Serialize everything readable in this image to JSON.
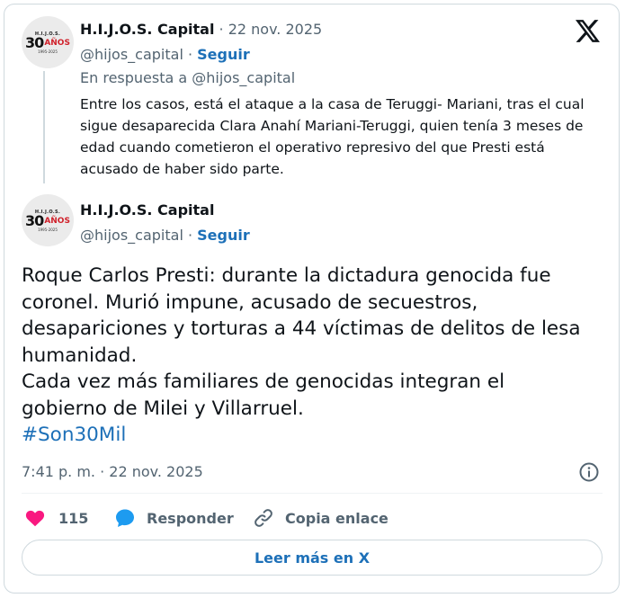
{
  "quoted_tweet": {
    "author_name": "H.I.J.O.S. Capital",
    "date": "22 nov. 2025",
    "handle": "@hijos_capital",
    "follow_label": "Seguir",
    "reply_to": "En respuesta a @hijos_capital",
    "text": "Entre los casos, está el ataque a la casa de Teruggi- Mariani, tras el cual sigue desaparecida Clara Anahí Mariani-Teruggi, quien tenía 3 meses de edad cuando cometieron el operativo represivo del que Presti está acusado de haber sido parte."
  },
  "avatar": {
    "top": "H.I.J.O.S.",
    "num": "30",
    "word": "AÑOS",
    "years": "1995-2025"
  },
  "main_tweet": {
    "author_name": "H.I.J.O.S. Capital",
    "handle": "@hijos_capital",
    "follow_label": "Seguir",
    "text_lines": [
      "Roque Carlos Presti: durante la dictadura genocida fue",
      "coronel. Murió impune, acusado de secuestros,",
      "desapariciones y torturas a 44 víctimas de delitos de lesa",
      "humanidad.",
      "Cada vez más familiares de genocidas integran el",
      "gobierno de Milei y Villarruel."
    ],
    "hashtag": "#Son30Mil",
    "timestamp": "7:41 p. m. · 22 nov. 2025"
  },
  "actions": {
    "likes": "115",
    "reply_label": "Responder",
    "copy_label": "Copia enlace"
  },
  "read_more_label": "Leer más en X",
  "colors": {
    "link": "#1d70b8",
    "like": "#f91880",
    "secondary_text": "#536471",
    "border": "#cfd9de"
  }
}
